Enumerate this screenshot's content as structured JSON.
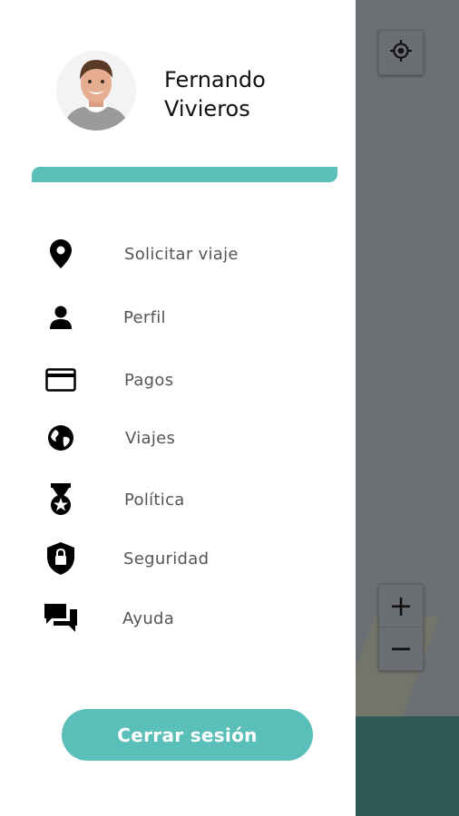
{
  "user": {
    "first_name": "Fernando",
    "last_name": "Vivieros"
  },
  "menu": [
    {
      "label": "Solicitar viaje",
      "icon": "location-pin-icon"
    },
    {
      "label": "Perfil",
      "icon": "person-icon"
    },
    {
      "label": "Pagos",
      "icon": "credit-card-icon"
    },
    {
      "label": "Viajes",
      "icon": "globe-icon"
    },
    {
      "label": "Política",
      "icon": "medal-icon"
    },
    {
      "label": "Seguridad",
      "icon": "shield-lock-icon"
    },
    {
      "label": "Ayuda",
      "icon": "chat-bubbles-icon"
    }
  ],
  "logout_label": "Cerrar sesión",
  "map_controls": {
    "zoom_in": "+",
    "zoom_out": "−"
  },
  "colors": {
    "accent": "#5bbfb9",
    "map_bottom": "#2f5a58",
    "scrim": "#6c6f74"
  }
}
